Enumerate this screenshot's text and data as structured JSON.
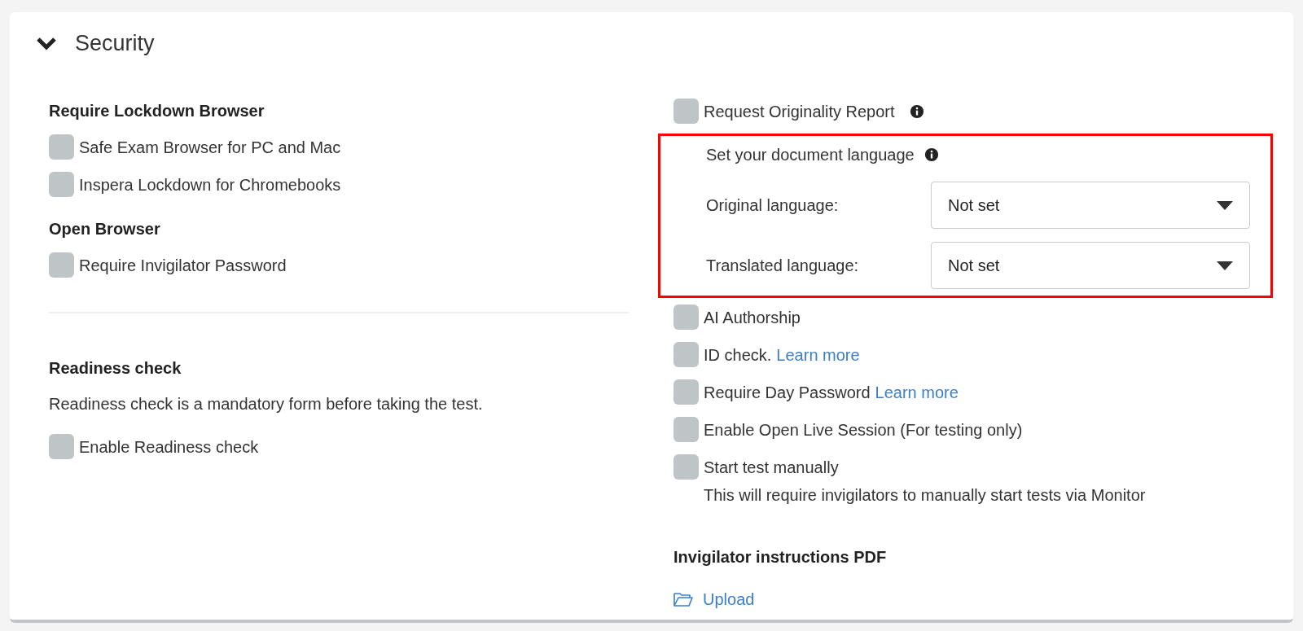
{
  "section": {
    "title": "Security",
    "expanded": true
  },
  "left": {
    "groups": [
      {
        "kind": "options",
        "heading": "Require Lockdown Browser",
        "options": [
          {
            "label": "Safe Exam Browser for PC and Mac",
            "checked": false
          },
          {
            "label": "Inspera Lockdown for Chromebooks",
            "checked": false
          }
        ]
      },
      {
        "kind": "options",
        "heading": "Open Browser",
        "options": [
          {
            "label": "Require Invigilator Password",
            "checked": false
          }
        ]
      },
      {
        "kind": "divider"
      },
      {
        "kind": "readiness",
        "heading": "Readiness check",
        "description": "Readiness check is a mandatory form before taking the test.",
        "options": [
          {
            "label": "Enable Readiness check",
            "checked": false
          }
        ]
      }
    ]
  },
  "right": {
    "originality": {
      "label": "Request Originality Report",
      "checked": false
    },
    "language": {
      "highlighted": true,
      "title": "Set your document language",
      "selects": [
        {
          "label": "Original language:",
          "value": "Not set"
        },
        {
          "label": "Translated language:",
          "value": "Not set"
        }
      ]
    },
    "options": [
      {
        "label": "AI Authorship",
        "checked": false
      },
      {
        "label": "ID check.",
        "link": "Learn more",
        "checked": false
      },
      {
        "label": "Require Day Password",
        "link": "Learn more",
        "checked": false
      },
      {
        "label": "Enable Open Live Session (For testing only)",
        "checked": false
      },
      {
        "label": "Start test manually",
        "note": "This will require invigilators to manually start tests via Monitor",
        "checked": false
      }
    ],
    "pdf": {
      "heading": "Invigilator instructions PDF",
      "upload": "Upload"
    }
  }
}
